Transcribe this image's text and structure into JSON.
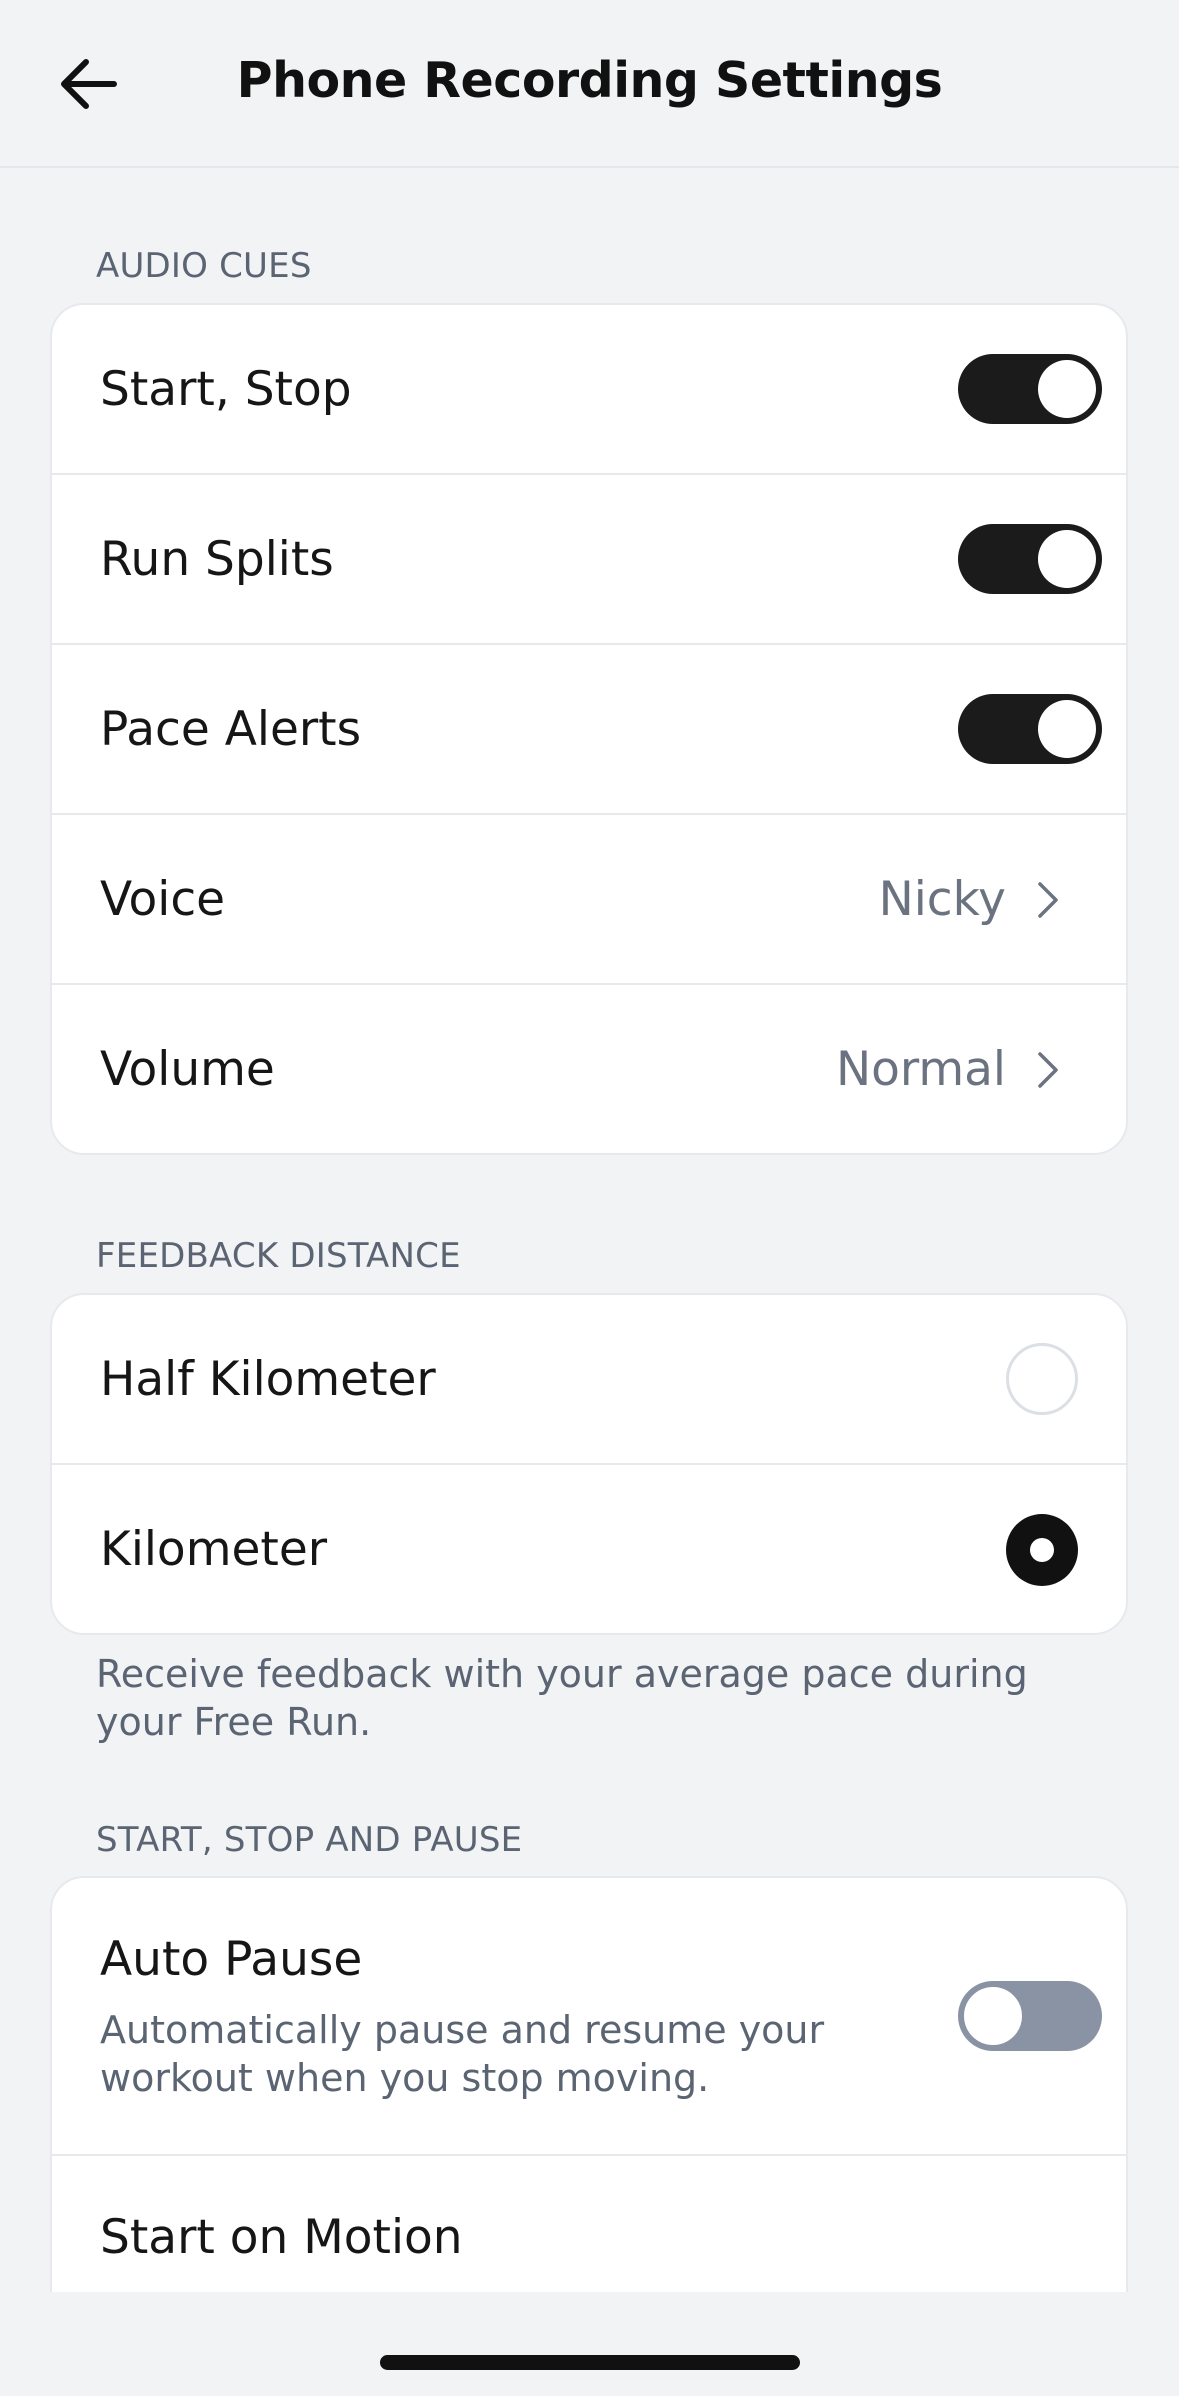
{
  "header": {
    "title": "Phone Recording Settings",
    "back_icon": "arrow-left-icon"
  },
  "audio_cues": {
    "label": "AUDIO CUES",
    "rows": [
      {
        "label": "Start, Stop",
        "type": "toggle",
        "on": true
      },
      {
        "label": "Run Splits",
        "type": "toggle",
        "on": true
      },
      {
        "label": "Pace Alerts",
        "type": "toggle",
        "on": true
      },
      {
        "label": "Voice",
        "type": "nav",
        "value": "Nicky"
      },
      {
        "label": "Volume",
        "type": "nav",
        "value": "Normal"
      }
    ]
  },
  "feedback_distance": {
    "label": "FEEDBACK DISTANCE",
    "options": [
      {
        "label": "Half Kilometer",
        "selected": false
      },
      {
        "label": "Kilometer",
        "selected": true
      }
    ],
    "helper": "Receive feedback with your average pace during your Free Run."
  },
  "start_stop_pause": {
    "label": "START, STOP AND PAUSE",
    "rows": [
      {
        "label": "Auto Pause",
        "description": "Automatically pause and resume your workout when you stop moving.",
        "on": false
      },
      {
        "label": "Start on Motion",
        "on": false
      }
    ]
  },
  "colors": {
    "background": "#f2f3f5",
    "toggle_on": "#1b1b1b",
    "toggle_off": "#8a93a3",
    "secondary_text": "#5b6473"
  }
}
